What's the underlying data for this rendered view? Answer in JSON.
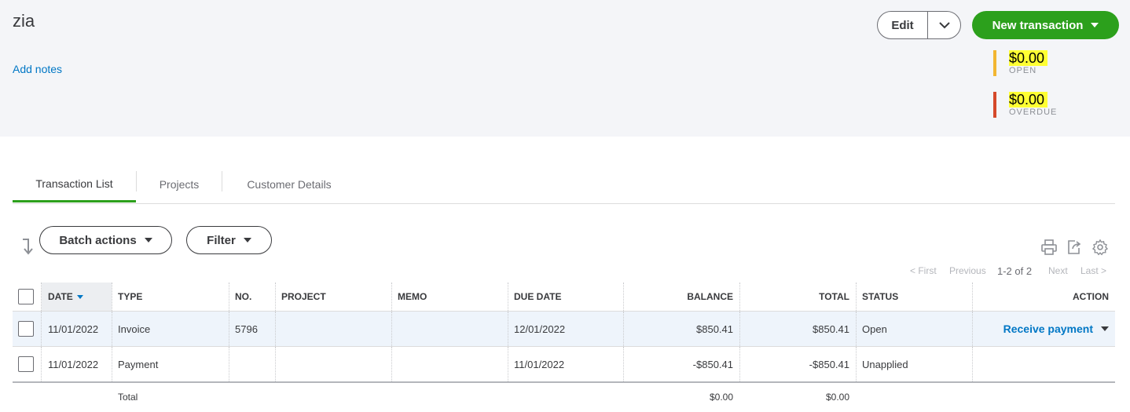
{
  "customer": {
    "name": "zia",
    "add_notes_label": "Add notes"
  },
  "header_actions": {
    "edit_label": "Edit",
    "new_transaction_label": "New transaction"
  },
  "summary": {
    "open": {
      "amount": "$0.00",
      "label": "OPEN",
      "color": "#f2b632"
    },
    "overdue": {
      "amount": "$0.00",
      "label": "OVERDUE",
      "color": "#d5492b"
    }
  },
  "tabs": [
    {
      "label": "Transaction List",
      "active": true
    },
    {
      "label": "Projects",
      "active": false
    },
    {
      "label": "Customer Details",
      "active": false
    }
  ],
  "toolbar": {
    "batch_actions_label": "Batch actions",
    "filter_label": "Filter"
  },
  "pager": {
    "first": "< First",
    "previous": "Previous",
    "count": "1-2 of 2",
    "next": "Next",
    "last": "Last >"
  },
  "table": {
    "headers": {
      "date": "DATE",
      "type": "TYPE",
      "no": "NO.",
      "project": "PROJECT",
      "memo": "MEMO",
      "due_date": "DUE DATE",
      "balance": "BALANCE",
      "total": "TOTAL",
      "status": "STATUS",
      "action": "ACTION"
    },
    "rows": [
      {
        "date": "11/01/2022",
        "type": "Invoice",
        "no": "5796",
        "project": "",
        "memo": "",
        "due_date": "12/01/2022",
        "balance": "$850.41",
        "total": "$850.41",
        "status": "Open",
        "action": "Receive payment"
      },
      {
        "date": "11/01/2022",
        "type": "Payment",
        "no": "",
        "project": "",
        "memo": "",
        "due_date": "11/01/2022",
        "balance": "-$850.41",
        "total": "-$850.41",
        "status": "Unapplied",
        "action": ""
      }
    ],
    "totals": {
      "label": "Total",
      "balance": "$0.00",
      "total": "$0.00"
    }
  },
  "colors": {
    "brand_green": "#2ca01c",
    "link_blue": "#0077c5",
    "highlight": "#ffff33"
  }
}
